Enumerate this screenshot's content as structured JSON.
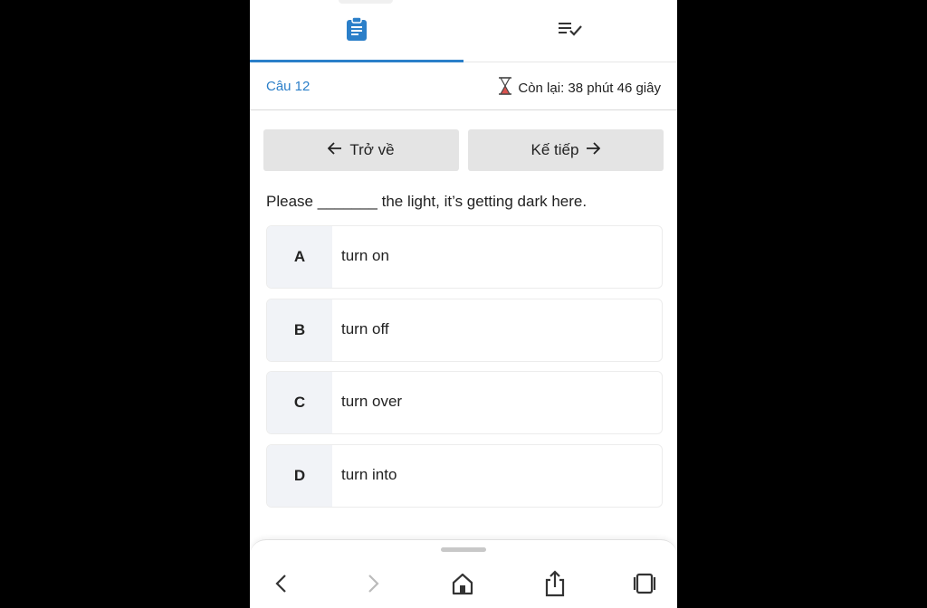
{
  "tabs": [
    {
      "name": "questions",
      "icon": "clipboard-icon",
      "active": true
    },
    {
      "name": "answered",
      "icon": "checklist-icon",
      "active": false
    }
  ],
  "question_bar": {
    "number_label": "Câu 12",
    "timer_icon": "hourglass-icon",
    "timer_text": "Còn lại: 38 phút 46 giây"
  },
  "navigation": {
    "back_label": "Trở về",
    "next_label": "Kế tiếp"
  },
  "question": {
    "text": "Please _______ the light, it’s getting dark here."
  },
  "options": [
    {
      "letter": "A",
      "text": "turn on"
    },
    {
      "letter": "B",
      "text": "turn off"
    },
    {
      "letter": "C",
      "text": "turn over"
    },
    {
      "letter": "D",
      "text": "turn into"
    }
  ],
  "browser_toolbar": {
    "icons": [
      "back-arrow-icon",
      "forward-arrow-icon",
      "home-icon",
      "share-icon",
      "tabs-icon"
    ]
  },
  "colors": {
    "accent": "#2b7fc9",
    "button_bg": "#e4e4e4",
    "option_letter_bg": "#f1f3f7"
  }
}
